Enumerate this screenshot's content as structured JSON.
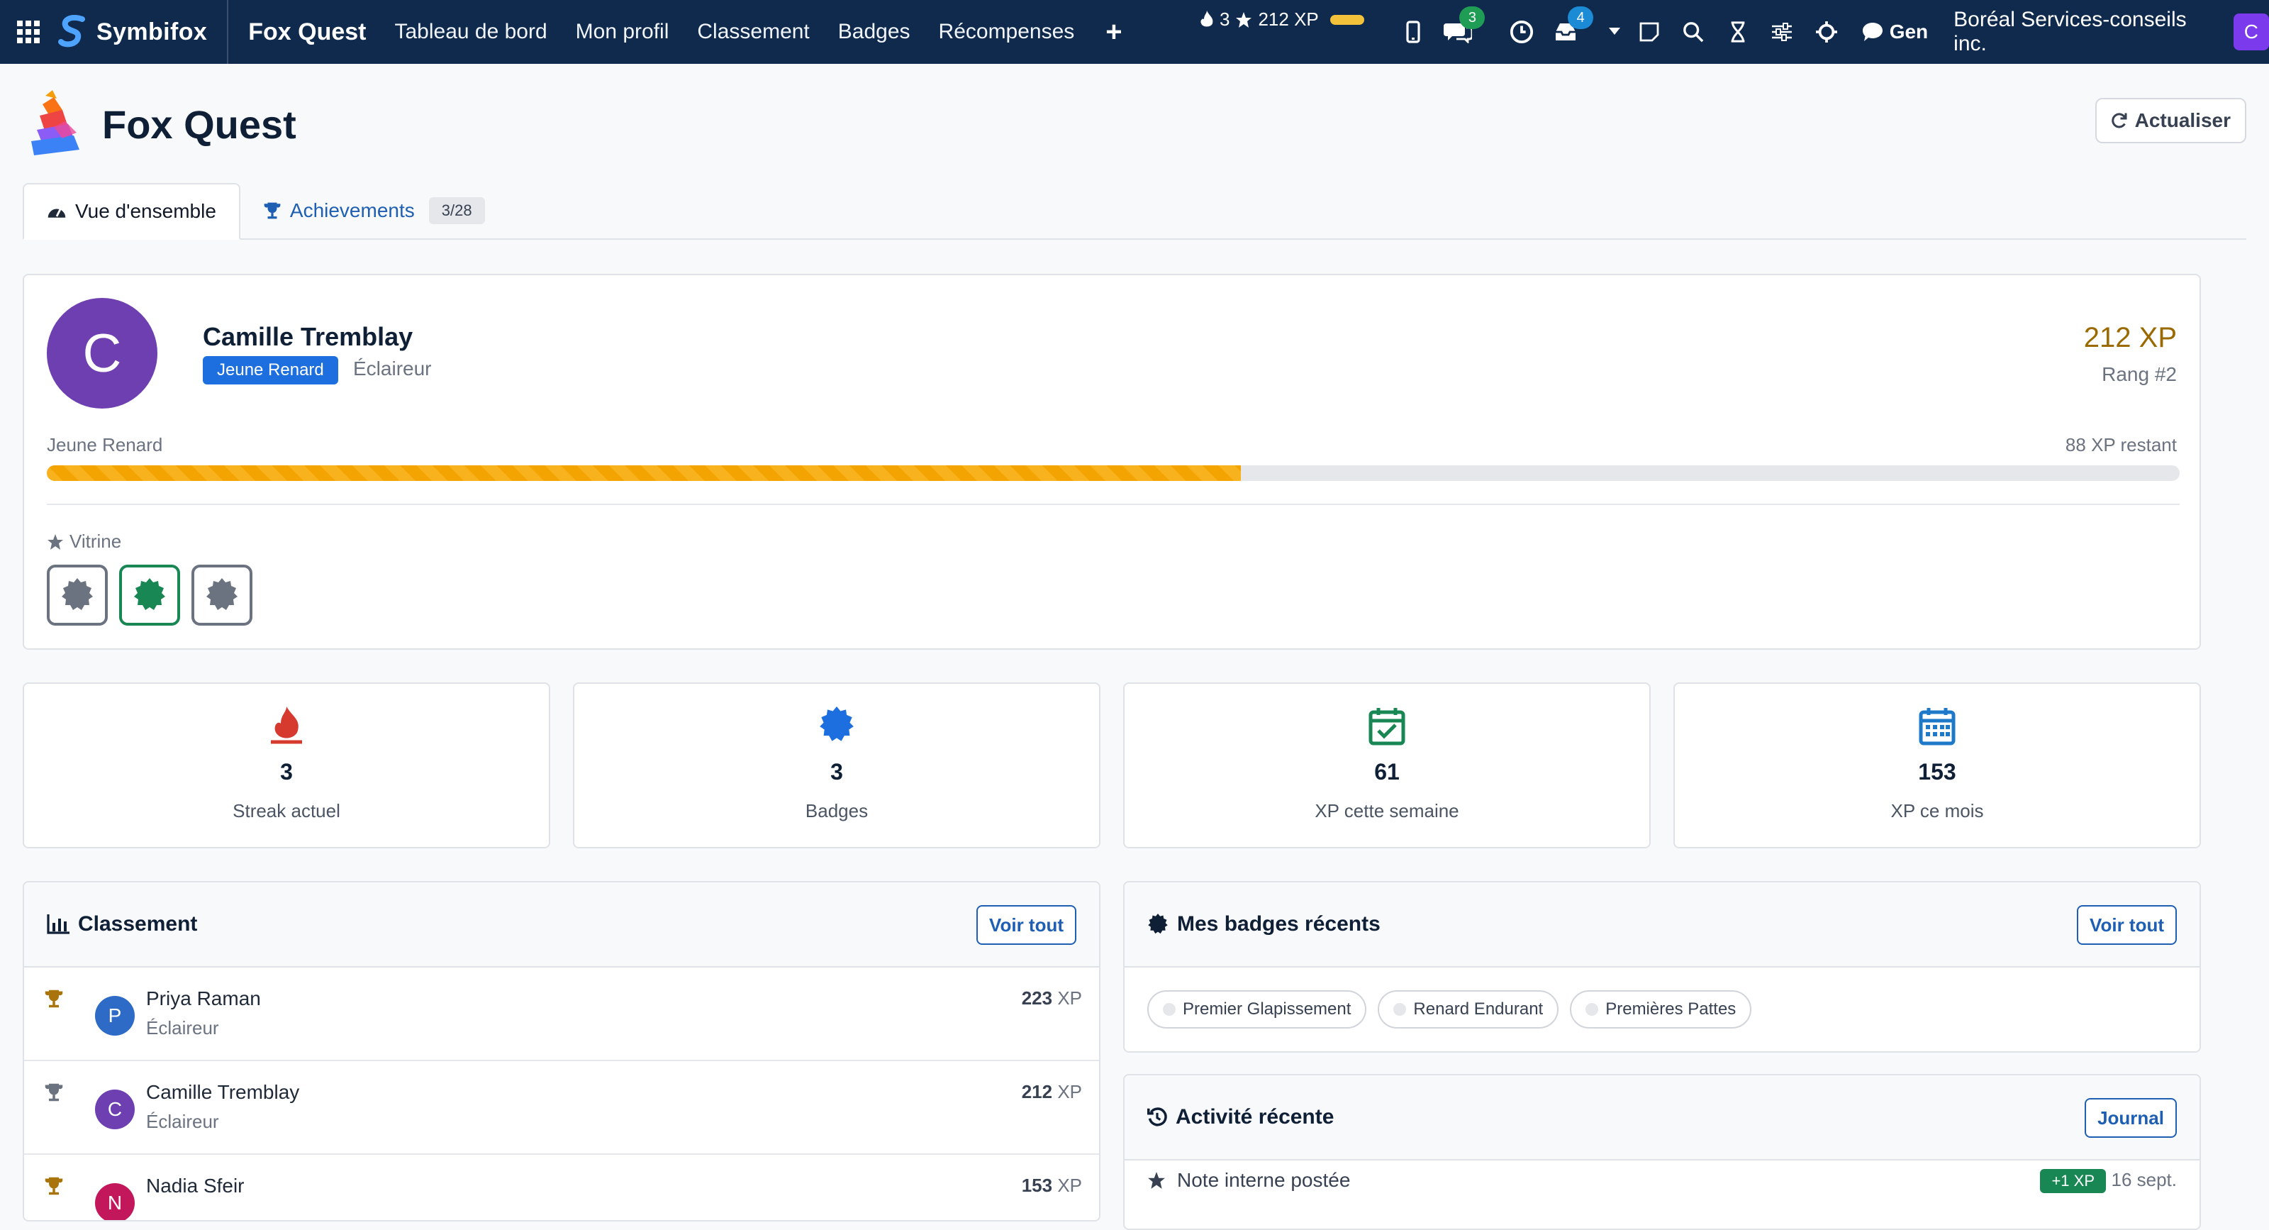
{
  "navbar": {
    "brand": "Symbifox",
    "app_title": "Fox Quest",
    "menu": [
      "Tableau de bord",
      "Mon profil",
      "Classement",
      "Badges",
      "Récompenses"
    ],
    "streak": "3",
    "xp": "212 XP",
    "chat_badge": "3",
    "activity_badge": "4",
    "gen_label": "Gen",
    "company": "Boréal Services-conseils inc.",
    "avatar_letter": "C"
  },
  "page": {
    "title": "Fox Quest",
    "refresh_label": "Actualiser"
  },
  "tabs": {
    "overview": "Vue d'ensemble",
    "achievements": "Achievements",
    "achievements_count": "3/28"
  },
  "profile": {
    "avatar_letter": "C",
    "name": "Camille Tremblay",
    "level_badge": "Jeune Renard",
    "rank_name": "Éclaireur",
    "xp": "212 XP",
    "rank": "Rang #2",
    "level_label": "Jeune Renard",
    "remaining": "88 XP restant",
    "progress_fraction": 0.56,
    "vitrine_label": "Vitrine"
  },
  "stats": [
    {
      "value": "3",
      "label": "Streak actuel",
      "icon": "flame-icon",
      "color": "#d63a2f"
    },
    {
      "value": "3",
      "label": "Badges",
      "icon": "badge-icon",
      "color": "#1d6fe0"
    },
    {
      "value": "61",
      "label": "XP cette semaine",
      "icon": "calendar-check-icon",
      "color": "#198754"
    },
    {
      "value": "153",
      "label": "XP ce mois",
      "icon": "calendar-icon",
      "color": "#1e7ac9"
    }
  ],
  "leaderboard": {
    "title": "Classement",
    "see_all": "Voir tout",
    "unit": "XP",
    "rows": [
      {
        "name": "Priya Raman",
        "rank": "Éclaireur",
        "xp": "223",
        "letter": "P",
        "avatar_color": "#2e6bc6",
        "trophy_color": "#a8740b"
      },
      {
        "name": "Camille Tremblay",
        "rank": "Éclaireur",
        "xp": "212",
        "letter": "C",
        "avatar_color": "#6d3fb1",
        "trophy_color": "#6b7280"
      },
      {
        "name": "Nadia Sfeir",
        "rank": "",
        "xp": "153",
        "letter": "N",
        "avatar_color": "#c2185b",
        "trophy_color": "#a8740b"
      }
    ]
  },
  "recent_badges": {
    "title": "Mes badges récents",
    "see_all": "Voir tout",
    "items": [
      "Premier Glapissement",
      "Renard Endurant",
      "Premières Pattes"
    ]
  },
  "activity": {
    "title": "Activité récente",
    "journal": "Journal",
    "rows": [
      {
        "text": "Note interne postée",
        "xp": "+1 XP",
        "date": "16 sept."
      }
    ]
  }
}
